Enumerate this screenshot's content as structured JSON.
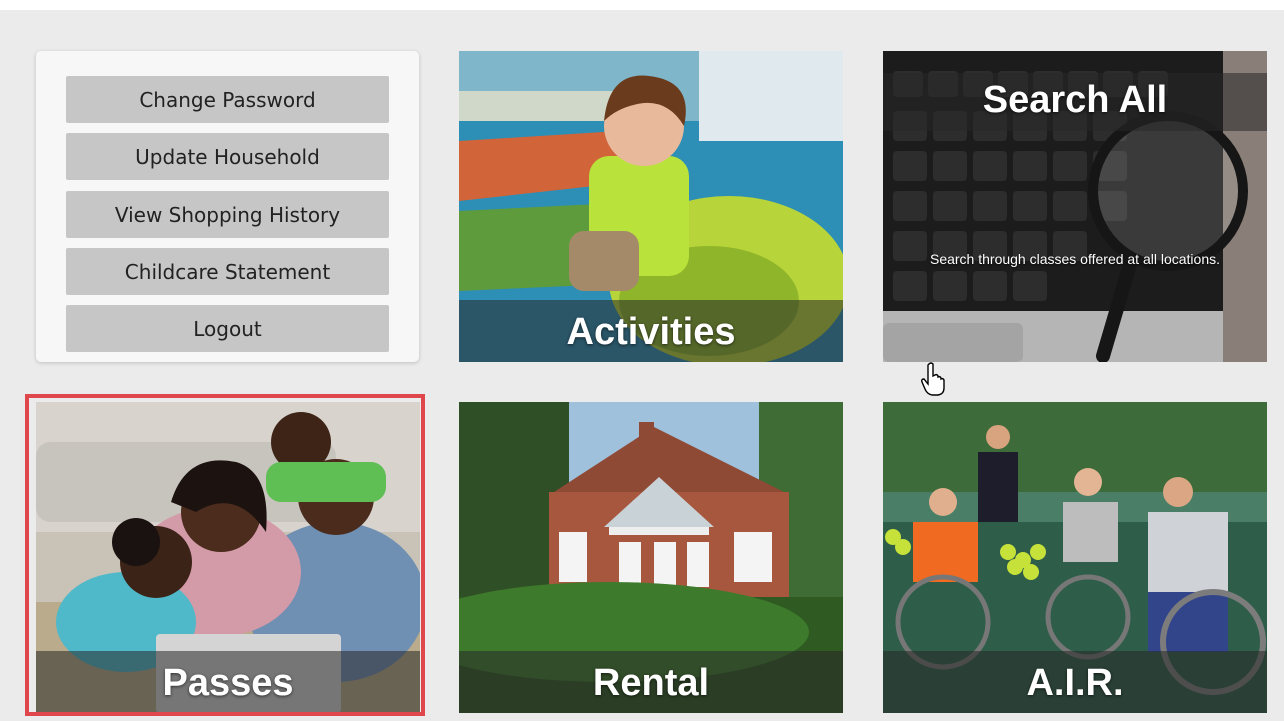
{
  "account_menu": {
    "buttons": [
      {
        "label": "Change Password"
      },
      {
        "label": "Update Household"
      },
      {
        "label": "View Shopping History"
      },
      {
        "label": "Childcare Statement"
      },
      {
        "label": "Logout"
      }
    ]
  },
  "tiles": {
    "activities": {
      "label": "Activities",
      "image": "child-on-playground-image"
    },
    "search_all": {
      "label": "Search All",
      "description": "Search through classes offered at all locations.",
      "image": "keyboard-magnifier-image"
    },
    "passes": {
      "label": "Passes",
      "image": "family-with-laptop-image",
      "selected": true
    },
    "rental": {
      "label": "Rental",
      "image": "brick-building-image"
    },
    "air": {
      "label": "A.I.R.",
      "image": "wheelchair-tennis-image"
    }
  },
  "colors": {
    "selection_outline": "#e0474c",
    "menu_button": "#c6c6c6",
    "page_background": "#ebebeb"
  },
  "cursor": {
    "icon": "hand-pointer-icon"
  }
}
